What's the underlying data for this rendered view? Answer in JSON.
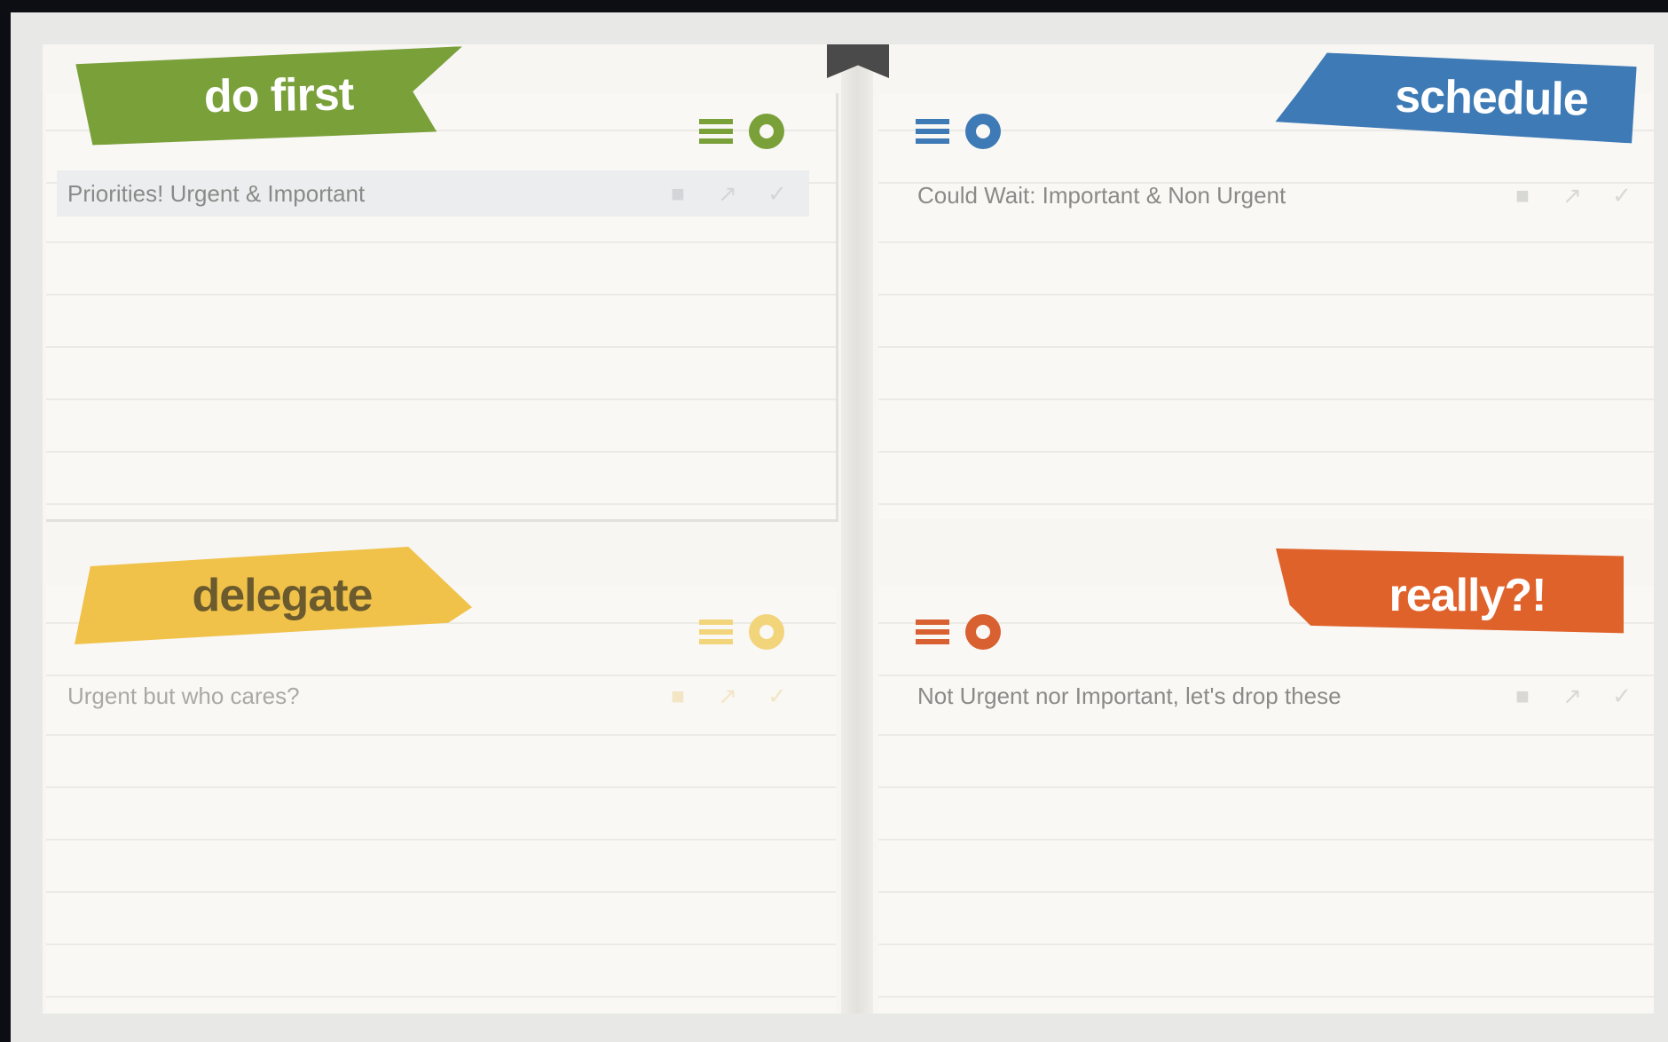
{
  "matrix": {
    "quadrants": [
      {
        "id": "do-first",
        "label": "do first",
        "color": "#7aa03a",
        "tasks": [
          {
            "text": "Priorities! Urgent & Important"
          }
        ]
      },
      {
        "id": "schedule",
        "label": "schedule",
        "color": "#3e7ab5",
        "tasks": [
          {
            "text": "Could Wait: Important & Non Urgent"
          }
        ]
      },
      {
        "id": "delegate",
        "label": "delegate",
        "color": "#f0c24a",
        "tasks": [
          {
            "text": "Urgent but who cares?"
          }
        ]
      },
      {
        "id": "really",
        "label": "really?!",
        "color": "#e0622b",
        "tasks": [
          {
            "text": "Not Urgent nor Important, let's drop these"
          }
        ]
      }
    ],
    "icons": {
      "list": "list-icon",
      "add": "add-circle-icon",
      "task_actions": [
        "delete-icon",
        "move-icon",
        "check-icon"
      ]
    }
  }
}
